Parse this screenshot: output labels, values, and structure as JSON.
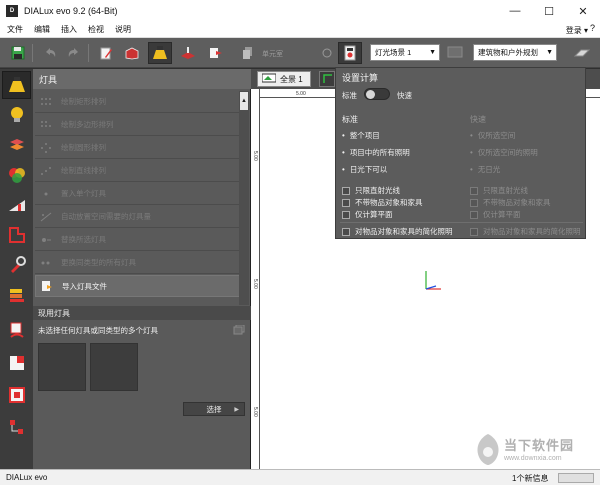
{
  "window": {
    "title": "DIALux evo 9.2  (64-Bit)",
    "logo_text": "D",
    "controls": {
      "minimize": "—",
      "maximize": "☐",
      "close": "✕"
    }
  },
  "menubar": {
    "items": [
      "文件",
      "编辑",
      "插入",
      "检视",
      "说明"
    ],
    "login": "登录 ▾",
    "help": "?"
  },
  "toolbar": {
    "mode_placeholder_text": "单元室",
    "lighting_scene_select": "灯光场景 1",
    "planning_select": "建筑物和户外规划",
    "icons": [
      "save-icon",
      "undo-icon",
      "redo-icon",
      "edit-icon",
      "room-icon",
      "light-cone-icon",
      "calc-floor-icon",
      "export-icon",
      "copy-icon",
      "calc-settings-icon",
      "monitor-icon",
      "eraser-icon"
    ]
  },
  "rail": {
    "icons": [
      "light-cone-icon",
      "bulb-icon",
      "arrange-icon",
      "color-icon",
      "slope-icon",
      "outline-icon",
      "wrench-icon",
      "stack-icon",
      "text-icon",
      "split-icon",
      "frame-icon",
      "tree-icon"
    ]
  },
  "lights_panel": {
    "title": "灯具",
    "items": [
      {
        "label": "绘制矩形排列",
        "enabled": false,
        "icon": "rect-array-icon"
      },
      {
        "label": "绘制多边形排列",
        "enabled": false,
        "icon": "polygon-array-icon"
      },
      {
        "label": "绘制圆形排列",
        "enabled": false,
        "icon": "circle-array-icon"
      },
      {
        "label": "绘制直线排列",
        "enabled": false,
        "icon": "line-array-icon"
      },
      {
        "label": "置入单个灯具",
        "enabled": false,
        "icon": "single-light-icon"
      },
      {
        "label": "自动放置空间需要的灯具量",
        "enabled": false,
        "icon": "auto-place-icon"
      },
      {
        "label": "替换所选灯具",
        "enabled": false,
        "icon": "replace-icon"
      },
      {
        "label": "更换同类型的所有灯具",
        "enabled": false,
        "icon": "replace-all-icon"
      },
      {
        "label": "导入灯具文件",
        "enabled": true,
        "icon": "import-file-icon"
      }
    ],
    "current_section": {
      "title": "现用灯具",
      "description": "未选择任何灯具或同类型的多个灯具",
      "select_button": "选择"
    }
  },
  "viewport": {
    "tab_label": "全景 1",
    "ruler_marks": {
      "h": "5.00",
      "v1": "5.00",
      "v2": "5.00",
      "v3": "5.00"
    }
  },
  "calc_popup": {
    "title": "设置计算",
    "toggle_left": "标准",
    "toggle_right": "快速",
    "toggle_state": "standard",
    "standard_col": {
      "heading": "标准",
      "options": [
        "整个项目",
        "项目中的所有照明",
        "日光下可以"
      ]
    },
    "fast_col": {
      "heading": "快速",
      "options": [
        "仅所选空间",
        "仅所选空间的照明",
        "无日光"
      ]
    },
    "checks_left": [
      "只限直射光线",
      "不带物品对象和家具",
      "仅计算平面"
    ],
    "checks_right": [
      "只限直射光线",
      "不带物品对象和家具",
      "仅计算平面"
    ],
    "bottom_check_left": "对物品对象和家具的简化照明",
    "bottom_check_right": "对物品对象和家具的简化照明"
  },
  "statusbar": {
    "brand": "DIALux evo",
    "info": "1个新信息"
  },
  "watermark": {
    "title": "当下软件园",
    "url": "www.downxia.com"
  },
  "colors": {
    "accent_yellow": "#f0c020",
    "toolbar_bg": "#5e5e5e",
    "panel_bg": "#5a5a5a",
    "axis_x": "#e03030",
    "axis_y": "#30b030",
    "axis_z": "#2050e0"
  }
}
